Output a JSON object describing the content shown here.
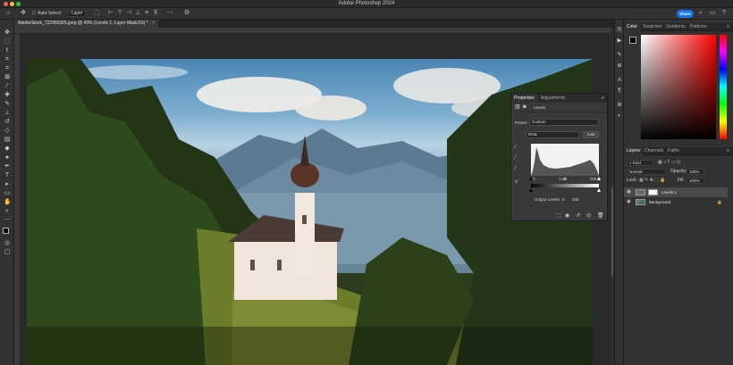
{
  "app": {
    "title": "Adobe Photoshop 2024"
  },
  "options_bar": {
    "auto_select_label": "Auto-Select:",
    "auto_select_target": "Layer",
    "share_label": "Share"
  },
  "document_tab": {
    "label": "AdobeStock_722960355.jpeg @ 43% (Levels 1, Layer Mask/16) *"
  },
  "color_panel": {
    "tabs": [
      "Color",
      "Swatches",
      "Gradients",
      "Patterns"
    ],
    "foreground": "#000000",
    "background": "#ffffff"
  },
  "properties_panel": {
    "tabs": [
      "Properties",
      "Adjustments"
    ],
    "section_label": "Levels",
    "preset_label": "Preset:",
    "preset_value": "Custom",
    "channel_value": "RGB",
    "auto_label": "Auto",
    "input_black": "0",
    "input_gamma": "1.00",
    "input_white": "255",
    "output_label": "Output Levels:",
    "output_black": "0",
    "output_white": "255"
  },
  "layers_panel": {
    "tabs": [
      "Layers",
      "Channels",
      "Paths"
    ],
    "filter_label": "Kind",
    "blend_mode": "Normal",
    "opacity_label": "Opacity:",
    "opacity_value": "100%",
    "lock_label": "Lock:",
    "fill_label": "Fill:",
    "fill_value": "100%",
    "layers": [
      {
        "name": "Levels 1",
        "selected": true
      },
      {
        "name": "Background",
        "selected": false
      }
    ]
  }
}
